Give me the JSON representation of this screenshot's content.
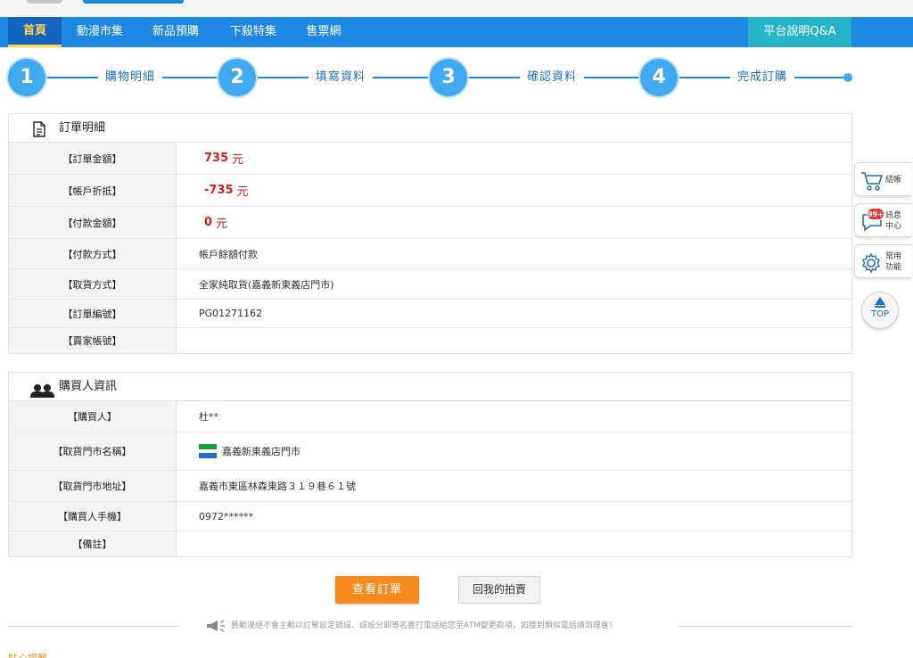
{
  "nav": {
    "items": [
      {
        "label": "首頁",
        "active": true
      },
      {
        "label": "動漫市集"
      },
      {
        "label": "新品預購"
      },
      {
        "label": "下殺特集"
      },
      {
        "label": "售票網"
      }
    ],
    "qa_label": "平台說明Q&A"
  },
  "steps": [
    {
      "num": "1",
      "label": "購物明細"
    },
    {
      "num": "2",
      "label": "填寫資料"
    },
    {
      "num": "3",
      "label": "確認資料"
    },
    {
      "num": "4",
      "label": "完成訂購"
    }
  ],
  "order": {
    "title": "訂單明細",
    "rows": [
      {
        "key": "【訂單金額】",
        "value": "735",
        "unit": "元",
        "highlight": true
      },
      {
        "key": "【帳戶折抵】",
        "value": "-735",
        "unit": "元",
        "highlight": true
      },
      {
        "key": "【付款金額】",
        "value": "0",
        "unit": "元",
        "highlight": true
      },
      {
        "key": "【付款方式】",
        "value": "帳戶餘額付款"
      },
      {
        "key": "【取貨方式】",
        "value": "全家純取貨(嘉義新東義店門市)"
      },
      {
        "key": "【訂單編號】",
        "value": "PG01271162"
      },
      {
        "key": "【賣家帳號】",
        "value": ""
      }
    ]
  },
  "buyer": {
    "title": "購買人資訊",
    "rows": [
      {
        "key": "【購買人】",
        "value": "杜**"
      },
      {
        "key": "【取貨門市名稱】",
        "value": "嘉義新東義店門市",
        "store_icon": "familymart-logo-icon"
      },
      {
        "key": "【取貨門市地址】",
        "value": "嘉義市東區林森東路３１９巷６１號"
      },
      {
        "key": "【購買人手機】",
        "value": "0972******"
      },
      {
        "key": "【備註】",
        "value": ""
      }
    ]
  },
  "buttons": {
    "view_order": "查看訂單",
    "back_to_auctions": "回我的拍賣"
  },
  "notice": "買動漫絕不會主動以訂單設定錯誤、誤設分期等名義打電話給您至ATM變更款項，如接到類似電話請勿理會！",
  "bottom_peek": "貼心提醒",
  "sidebar": {
    "checkout": "結帳",
    "messages_line1": "訊息",
    "messages_line2": "中心",
    "messages_badge": "99+",
    "tools_line1": "常用",
    "tools_line2": "功能",
    "top": "TOP"
  },
  "colors": {
    "nav_blue": "#1e88e5",
    "nav_active": "#1565c0",
    "qa_teal": "#26b5c8",
    "price_red": "#e01b1b",
    "primary_orange": "#f68a1e"
  }
}
